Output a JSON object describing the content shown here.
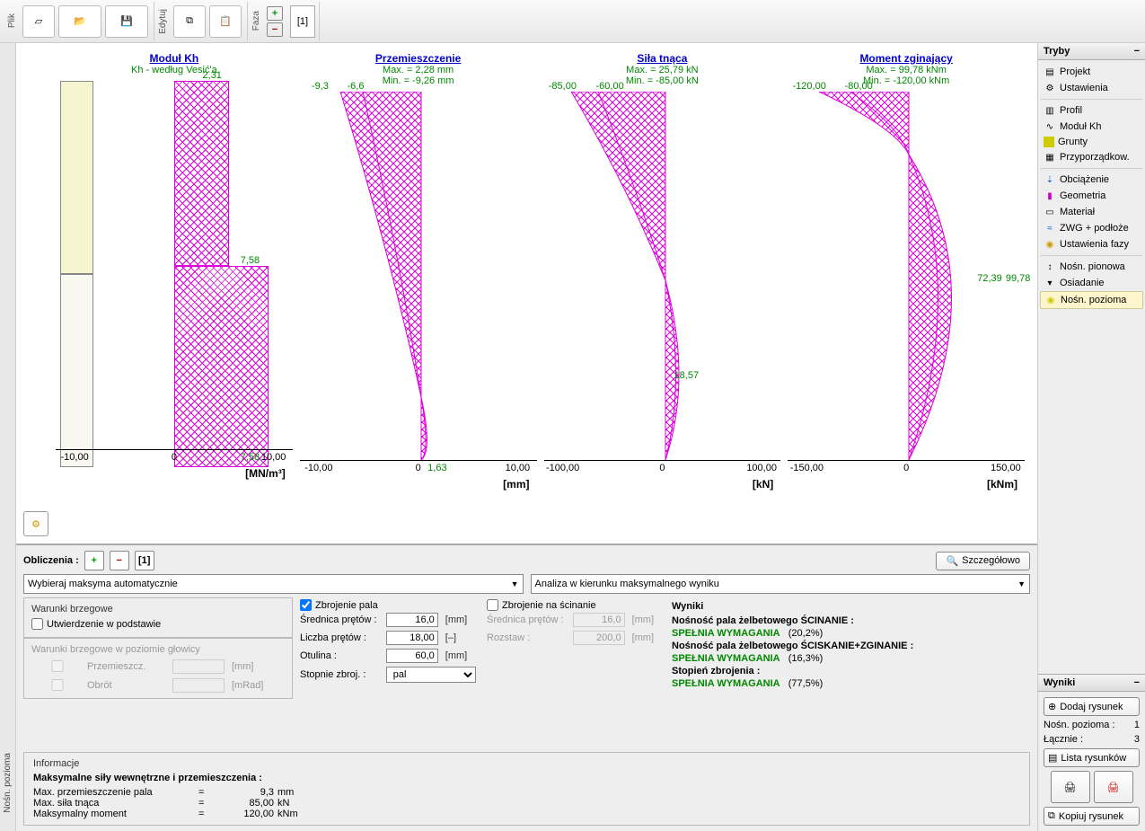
{
  "toolbar": {
    "file_label": "Plik",
    "edit_label": "Edytuj",
    "phase_label": "Faza",
    "phase_indicator": "[1]"
  },
  "chart_data": [
    {
      "type": "area",
      "title": "Moduł Kh",
      "subtitle": "Kh - według Vesić'a",
      "xlabel": "",
      "ylabel": "",
      "unit": "[MN/m³]",
      "xlim": [
        -10,
        10
      ],
      "ticks": [
        "-10,00",
        "0",
        "10,00"
      ],
      "annotations": [
        "2,31",
        "7,58",
        "7,58"
      ]
    },
    {
      "type": "area",
      "title": "Przemieszczenie",
      "subtitle_max": "Max. = 2,28 mm",
      "subtitle_min": "Min. = -9,26 mm",
      "unit": "[mm]",
      "xlim": [
        -10,
        10
      ],
      "ticks": [
        "-10,00",
        "0",
        "10,00"
      ],
      "annotations": [
        "-9,3",
        "-6,6",
        "1,63"
      ]
    },
    {
      "type": "area",
      "title": "Siła tnąca",
      "subtitle_max": "Max. = 25,79 kN",
      "subtitle_min": "Min. = -85,00 kN",
      "unit": "[kN]",
      "xlim": [
        -100,
        100
      ],
      "ticks": [
        "-100,00",
        "0",
        "100,00"
      ],
      "annotations": [
        "-85,00",
        "-60,00",
        "18,57"
      ]
    },
    {
      "type": "area",
      "title": "Moment zginający",
      "subtitle_max": "Max. = 99,78 kNm",
      "subtitle_min": "Min. = -120,00 kNm",
      "unit": "[kNm]",
      "xlim": [
        -150,
        150
      ],
      "ticks": [
        "-150,00",
        "0",
        "150,00"
      ],
      "annotations": [
        "-120,00",
        "-80,00",
        "72,39",
        "99,78"
      ]
    }
  ],
  "bottom": {
    "calc_label": "Obliczenia :",
    "phase": "[1]",
    "detail_btn": "Szczegółowo",
    "dd1": "Wybieraj maksyma automatycznie",
    "dd2": "Analiza w kierunku maksymalnego wyniku",
    "bc": {
      "title": "Warunki brzegowe",
      "fix_base": "Utwierdzenie w podstawie",
      "head_title": "Warunki brzegowe w poziomie głowicy",
      "disp": "Przemieszcz.",
      "disp_unit": "[mm]",
      "rot": "Obrót",
      "rot_unit": "[mRad]"
    },
    "reinf": {
      "title": "Zbrojenie pala",
      "bar_dia": "Średnica prętów :",
      "bar_dia_val": "16,0",
      "bar_dia_unit": "[mm]",
      "bar_num": "Liczba prętów :",
      "bar_num_val": "18,00",
      "bar_num_unit": "[–]",
      "cover": "Otulina :",
      "cover_val": "60,0",
      "cover_unit": "[mm]",
      "degree": "Stopnie zbroj. :",
      "degree_val": "pal",
      "shear": "Zbrojenie na ścinanie",
      "shear_dia": "Średnica prętów :",
      "shear_dia_val": "16,0",
      "shear_dia_unit": "[mm]",
      "spacing": "Rozstaw :",
      "spacing_val": "200,0",
      "spacing_unit": "[mm]"
    },
    "results": {
      "title": "Wyniki",
      "l1": "Nośność pala żelbetowego ŚCINANIE :",
      "l1r": "SPEŁNIA WYMAGANIA",
      "l1p": "(20,2%)",
      "l2": "Nośność pala żelbetowego ŚCISKANIE+ZGINANIE :",
      "l2r": "SPEŁNIA WYMAGANIA",
      "l2p": "(16,3%)",
      "l3": "Stopień zbrojenia :",
      "l3r": "SPEŁNIA WYMAGANIA",
      "l3p": "(77,5%)"
    },
    "info": {
      "title": "Informacje",
      "heading": "Maksymalne siły wewnętrzne i przemieszczenia :",
      "r1l": "Max. przemieszczenie pala",
      "r1v": "9,3",
      "r1u": "mm",
      "r2l": "Max. siła tnąca",
      "r2v": "85,00",
      "r2u": "kN",
      "r3l": "Maksymalny moment",
      "r3v": "120,00",
      "r3u": "kNm"
    }
  },
  "right": {
    "tryby": "Tryby",
    "items": [
      {
        "label": "Projekt"
      },
      {
        "label": "Ustawienia"
      },
      {
        "label": "Profil"
      },
      {
        "label": "Moduł Kh"
      },
      {
        "label": "Grunty"
      },
      {
        "label": "Przyporządkow."
      },
      {
        "label": "Obciążenie"
      },
      {
        "label": "Geometria"
      },
      {
        "label": "Materiał"
      },
      {
        "label": "ZWG + podłoże"
      },
      {
        "label": "Ustawienia fazy"
      },
      {
        "label": "Nośn. pionowa"
      },
      {
        "label": "Osiadanie"
      },
      {
        "label": "Nośn. pozioma"
      }
    ],
    "wyniki": "Wyniki",
    "add_draw": "Dodaj rysunek",
    "nosn": "Nośn. pozioma :",
    "nosn_v": "1",
    "lacz": "Łącznie :",
    "lacz_v": "3",
    "list_draw": "Lista rysunków",
    "copy_draw": "Kopiuj rysunek"
  },
  "left_label": "Nośn. pozioma"
}
